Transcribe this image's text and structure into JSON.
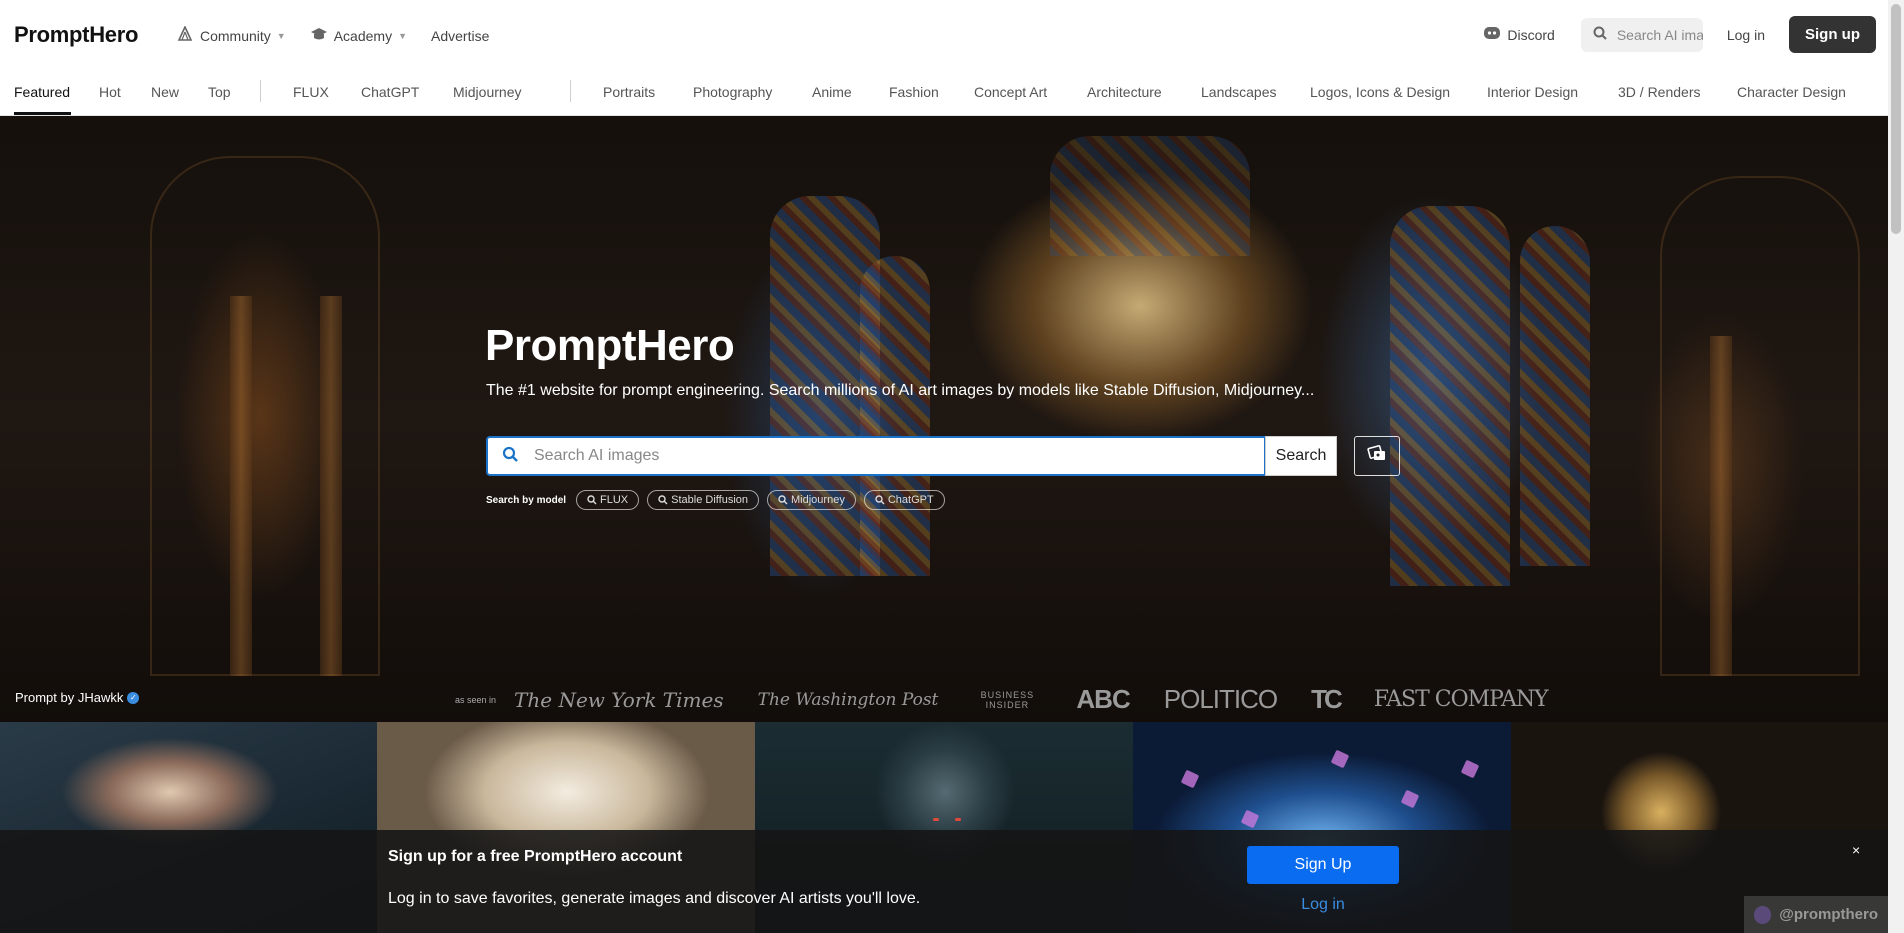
{
  "header": {
    "logo": "PromptHero",
    "nav": [
      {
        "label": "Community"
      },
      {
        "label": "Academy"
      },
      {
        "label": "Advertise"
      }
    ],
    "discord_label": "Discord",
    "search_placeholder": "Search AI images",
    "login_label": "Log in",
    "signup_label": "Sign up"
  },
  "categories": {
    "primary": [
      "Featured",
      "Hot",
      "New",
      "Top"
    ],
    "models": [
      "FLUX",
      "ChatGPT",
      "Midjourney"
    ],
    "topics": [
      "Portraits",
      "Photography",
      "Anime",
      "Fashion",
      "Concept Art",
      "Architecture",
      "Landscapes",
      "Logos, Icons & Design",
      "Interior Design",
      "3D / Renders",
      "Character Design"
    ],
    "active": "Featured"
  },
  "hero": {
    "title": "PromptHero",
    "subtitle": "The #1 website for prompt engineering. Search millions of AI art images by models like Stable Diffusion, Midjourney...",
    "search_placeholder": "Search AI images",
    "search_button": "Search",
    "search_by_model_label": "Search by model",
    "model_pills": [
      "FLUX",
      "Stable Diffusion",
      "Midjourney",
      "ChatGPT"
    ],
    "prompt_by": "Prompt by JHawkk",
    "as_seen_in_label": "as seen in",
    "press": [
      "The New York Times",
      "The Washington Post",
      "BUSINESS INSIDER",
      "ABC",
      "POLITICO",
      "TC",
      "FAST COMPANY"
    ]
  },
  "banner": {
    "title": "Sign up for a free PromptHero account",
    "text": "Log in to save favorites, generate images and discover AI artists you'll love.",
    "signup_button": "Sign Up",
    "login_link": "Log in",
    "close": "×"
  },
  "watermark": "@prompthero",
  "colors": {
    "primary_button": "#0a6cf0",
    "signup_dark": "#333333",
    "search_border": "#1a73c8"
  }
}
